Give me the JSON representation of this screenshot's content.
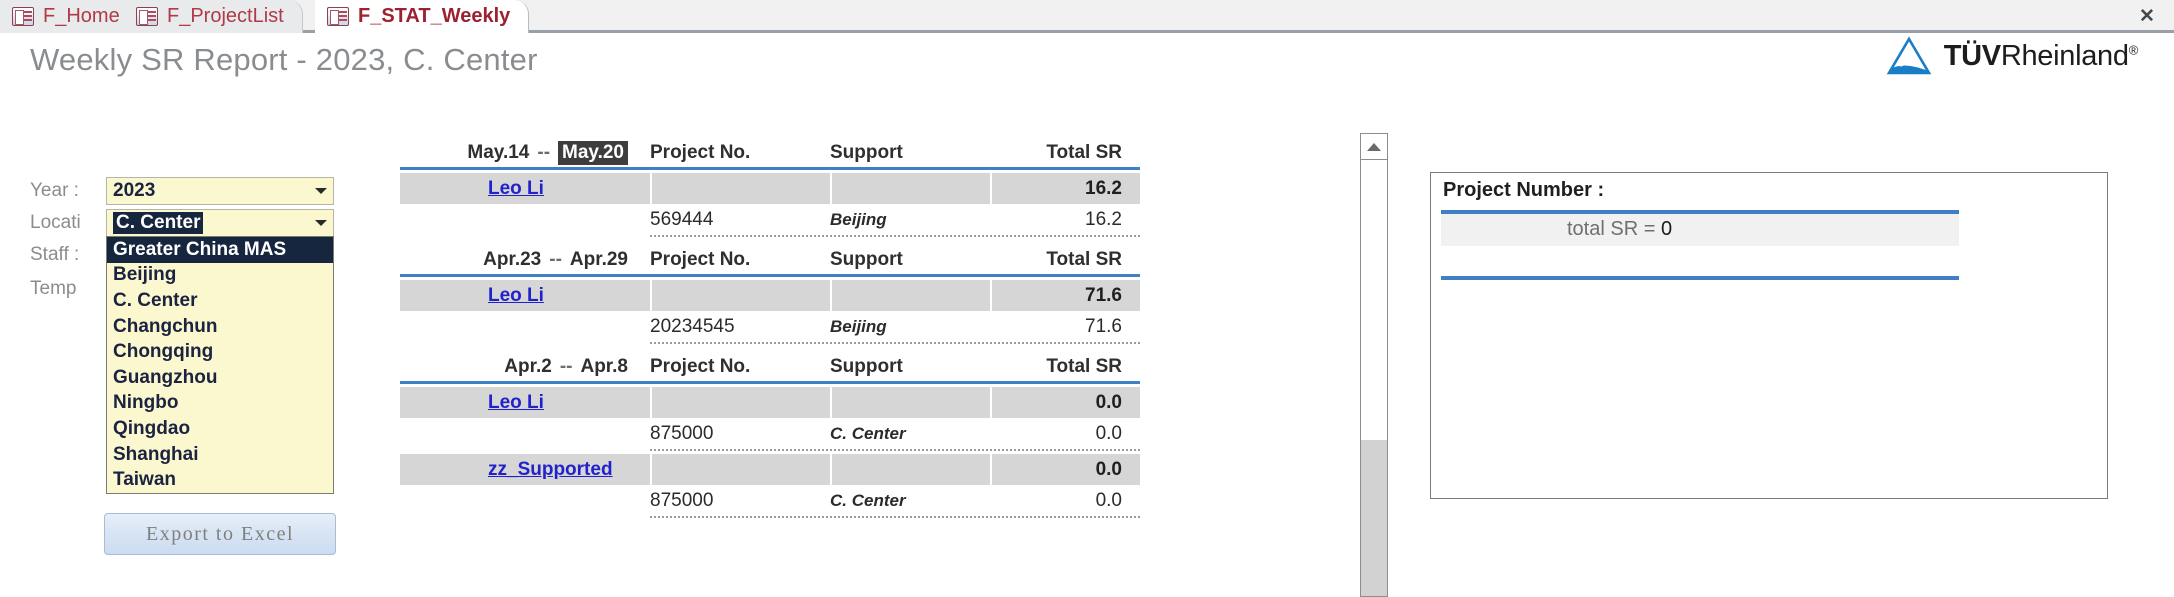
{
  "window": {
    "close_label": "✕",
    "tabs": [
      {
        "label": "F_Home",
        "active": false
      },
      {
        "label": "F_ProjectList",
        "active": false
      },
      {
        "label": "F_STAT_Weekly",
        "active": true
      }
    ]
  },
  "header": {
    "title": "Weekly SR Report - 2023, C. Center",
    "logo_text_bold": "TÜV",
    "logo_text_rest": "Rheinland",
    "logo_sup": "®",
    "accent_blue": "#3f7fc4",
    "logo_blue": "#1a7ec6"
  },
  "filters": {
    "labels": {
      "year": "Year :",
      "location": "Locati",
      "staff": "Staff :",
      "temp": "Temp"
    },
    "year_value": "2023",
    "location_value": "C. Center",
    "location_options": [
      "Greater China MAS",
      "Beijing",
      "C. Center",
      "Changchun",
      "Chongqing",
      "Guangzhou",
      "Ningbo",
      "Qingdao",
      "Shanghai",
      "Taiwan"
    ],
    "location_selected_index": 0,
    "export_label": "Export to Excel"
  },
  "report": {
    "columns": {
      "project_no": "Project No.",
      "support": "Support",
      "total_sr": "Total SR"
    },
    "period_separator": "--",
    "groups": [
      {
        "period_start": "May.14",
        "period_end": "May.20",
        "period_end_highlighted": true,
        "rows": [
          {
            "staff": "Leo Li",
            "staff_total": "16.2",
            "details": [
              {
                "project_no": "569444",
                "support": "Beijing",
                "total_sr": "16.2"
              }
            ]
          }
        ]
      },
      {
        "period_start": "Apr.23",
        "period_end": "Apr.29",
        "period_end_highlighted": false,
        "rows": [
          {
            "staff": "Leo Li",
            "staff_total": "71.6",
            "details": [
              {
                "project_no": "20234545",
                "support": "Beijing",
                "total_sr": "71.6"
              }
            ]
          }
        ]
      },
      {
        "period_start": "Apr.2",
        "period_end": "Apr.8",
        "period_end_highlighted": false,
        "rows": [
          {
            "staff": "Leo Li",
            "staff_total": "0.0",
            "details": [
              {
                "project_no": "875000",
                "support": "C. Center",
                "total_sr": "0.0"
              }
            ]
          },
          {
            "staff": "zz_Supported",
            "staff_total": "0.0",
            "details": [
              {
                "project_no": "875000",
                "support": "C. Center",
                "total_sr": "0.0"
              }
            ]
          }
        ]
      }
    ]
  },
  "detail_panel": {
    "title": "Project Number :",
    "total_label": "total SR = ",
    "total_value": "0"
  }
}
